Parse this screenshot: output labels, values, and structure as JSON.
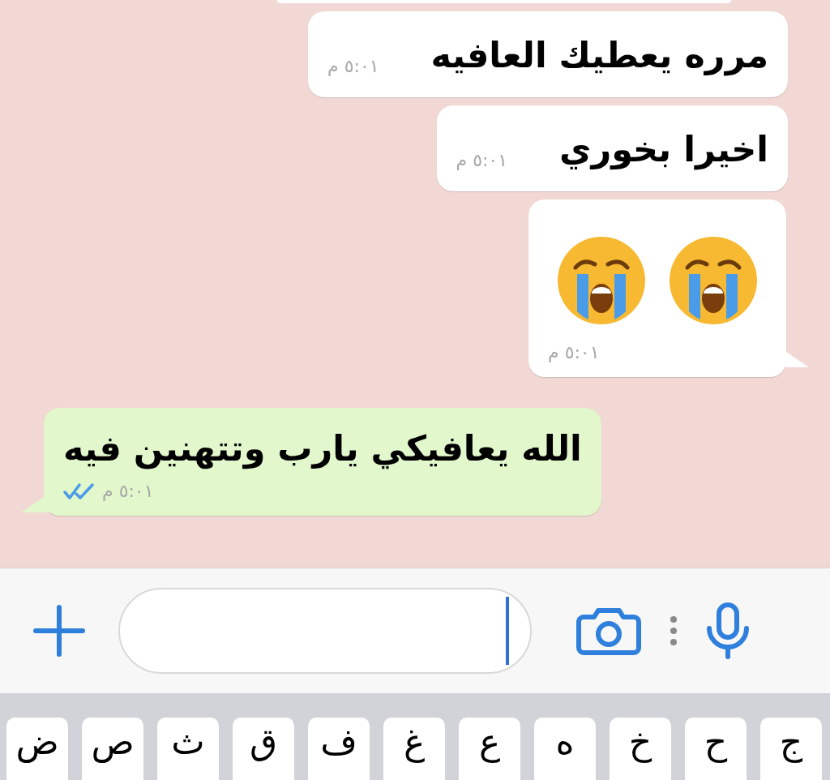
{
  "messages": [
    {
      "kind": "text",
      "outgoing": false,
      "text": "مرره يعطيك العافيه",
      "time": "٥:٠١ م"
    },
    {
      "kind": "text",
      "outgoing": false,
      "text": "اخيرا بخوري",
      "time": "٥:٠١ م"
    },
    {
      "kind": "emoji",
      "outgoing": false,
      "time": "٥:٠١ م"
    },
    {
      "kind": "text",
      "outgoing": true,
      "text": "الله يعافيكي يارب وتتهنين فيه",
      "time": "٥:٠١ م",
      "read": true
    }
  ],
  "composer": {
    "cursor": true
  },
  "keyboard": {
    "keys": [
      "ج",
      "ح",
      "خ",
      "ه",
      "ع",
      "غ",
      "ف",
      "ق",
      "ث",
      "ص",
      "ض"
    ]
  }
}
